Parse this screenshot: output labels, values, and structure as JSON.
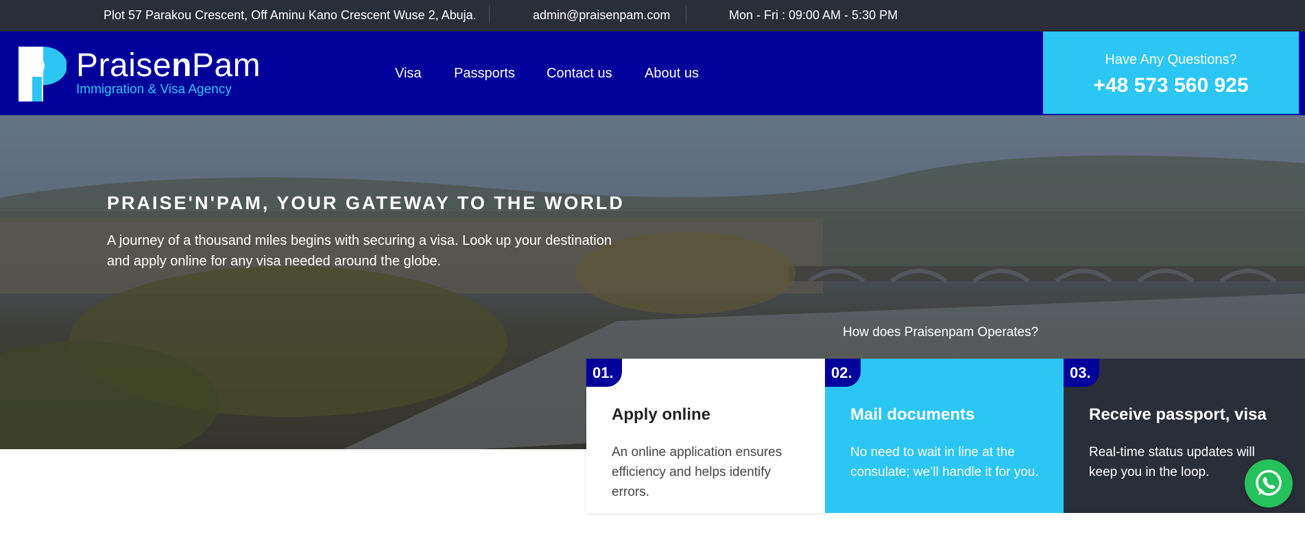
{
  "topbar": {
    "address": "Plot 57 Parakou Crescent, Off Aminu Kano Crescent Wuse 2, Abuja.",
    "email": "admin@praisenpam.com",
    "hours": "Mon - Fri : 09:00 AM - 5:30 PM"
  },
  "header": {
    "logo": {
      "word_start": "Praise",
      "word_mid": "n",
      "word_end": "Pam",
      "tagline": "Immigration & Visa Agency"
    },
    "nav": [
      {
        "label": "Visa"
      },
      {
        "label": "Passports"
      },
      {
        "label": "Contact us"
      },
      {
        "label": "About us"
      }
    ],
    "questions": {
      "label": "Have Any Questions?",
      "phone": "+48 573 560 925"
    }
  },
  "hero": {
    "title": "PRAISE'N'PAM, YOUR GATEWAY TO THE WORLD",
    "subtitle": "A journey of a thousand miles begins with securing a visa. Look up your destination and apply online for any visa needed around the globe.",
    "how_label": "How does Praisenpam Operates?"
  },
  "steps": [
    {
      "num": "01.",
      "title": "Apply online",
      "text": "An online application ensures efficiency and helps identify errors."
    },
    {
      "num": "02.",
      "title": "Mail documents",
      "text": "No need to wait in line at the consulate; we’ll handle it for you."
    },
    {
      "num": "03.",
      "title": "Receive passport, visa",
      "text": "Real-time status updates will keep you in the loop."
    }
  ],
  "colors": {
    "topbar": "#2a2e38",
    "brand_blue": "#00009b",
    "accent_cyan": "#2bc6f3",
    "whatsapp_green": "#25c15c"
  },
  "icons": {
    "logo": "praisenpam-p-logo",
    "chat": "whatsapp-icon"
  }
}
